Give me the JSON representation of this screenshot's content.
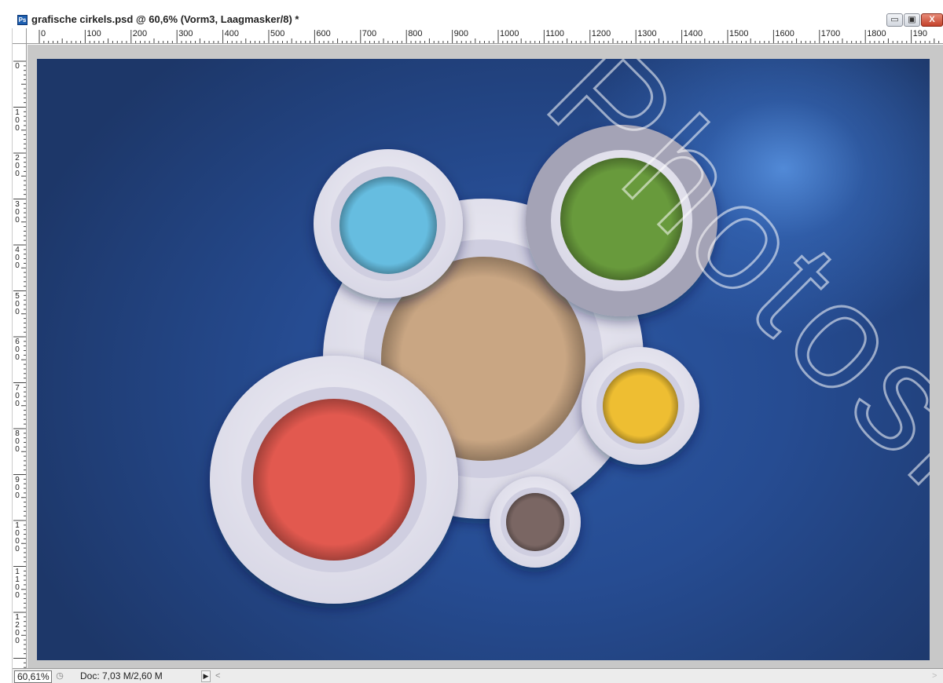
{
  "window": {
    "title": "grafische cirkels.psd @ 60,6% (Vorm3, Laagmasker/8) *",
    "app_icon_label": "Ps",
    "minimize_glyph": "▭",
    "maximize_glyph": "▣",
    "close_glyph": "X"
  },
  "ruler_h": [
    "0",
    "100",
    "200",
    "300",
    "400",
    "500",
    "600",
    "700",
    "800",
    "900",
    "1000",
    "1100",
    "1200",
    "1300",
    "1400",
    "1500",
    "1600",
    "1700",
    "1800",
    "190"
  ],
  "ruler_v": [
    "0",
    "100",
    "200",
    "300",
    "400",
    "500",
    "600",
    "700",
    "800",
    "900",
    "1000",
    "1100",
    "1200"
  ],
  "canvas": {
    "background_color": "#264c92",
    "circles": [
      {
        "name": "blue",
        "color": "#66bde0"
      },
      {
        "name": "green",
        "color": "#689a3c"
      },
      {
        "name": "beige",
        "color": "#c9a683"
      },
      {
        "name": "yellow",
        "color": "#eebe32"
      },
      {
        "name": "red",
        "color": "#e2594f"
      },
      {
        "name": "brown",
        "color": "#7a6663"
      }
    ],
    "watermark": "Photoshop"
  },
  "status": {
    "zoom": "60,61%",
    "doc": "Doc: 7,03 M/2,60 M",
    "arrow_glyph": "▶",
    "scroll_left_glyph": "<",
    "scroll_right_glyph": ">"
  }
}
